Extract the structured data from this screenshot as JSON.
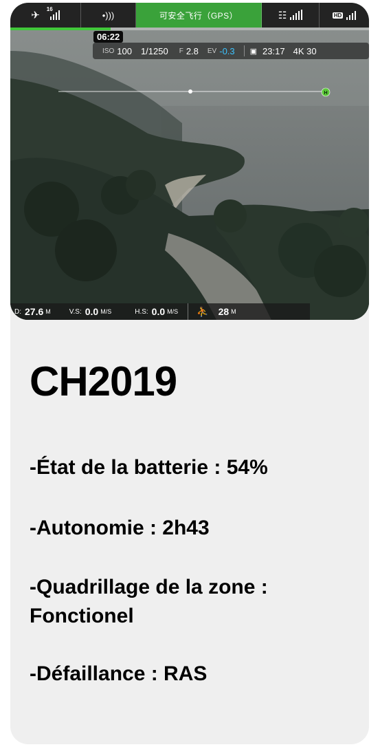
{
  "topbar": {
    "satellite_count": "16",
    "gps_status": "可安全飞行（GPS）",
    "hd_label": "HD"
  },
  "recording": {
    "elapsed": "06:22",
    "progress_fraction": 0.28
  },
  "exposure": {
    "iso_label": "ISO",
    "iso_value": "100",
    "shutter": "1/1250",
    "f_label": "F",
    "f_value": "2.8",
    "ev_label": "EV",
    "ev_value": "-0.3",
    "remaining_time": "23:17",
    "resolution": "4K 30"
  },
  "telemetry": {
    "d_label": "D:",
    "d_value": "27.6",
    "d_unit": "M",
    "vs_label": "V.S:",
    "vs_value": "0.0",
    "vs_unit": "M/S",
    "hs_label": "H.S:",
    "hs_value": "0.0",
    "hs_unit": "M/S",
    "height_value": "28",
    "height_unit": "M"
  },
  "horizon": {
    "home_marker": "H"
  },
  "report": {
    "title": "CH2019",
    "battery": "-État de la batterie : 54%",
    "autonomy": "-Autonomie : 2h43",
    "grid_line1": "-Quadrillage de la zone :",
    "grid_line2": "Fonctionel",
    "failure": "-Défaillance : RAS"
  },
  "colors": {
    "gps_ok": "#3aa23a",
    "ev_accent": "#3cc3ff",
    "progress": "#41c83a",
    "card_bg": "#efefef"
  }
}
